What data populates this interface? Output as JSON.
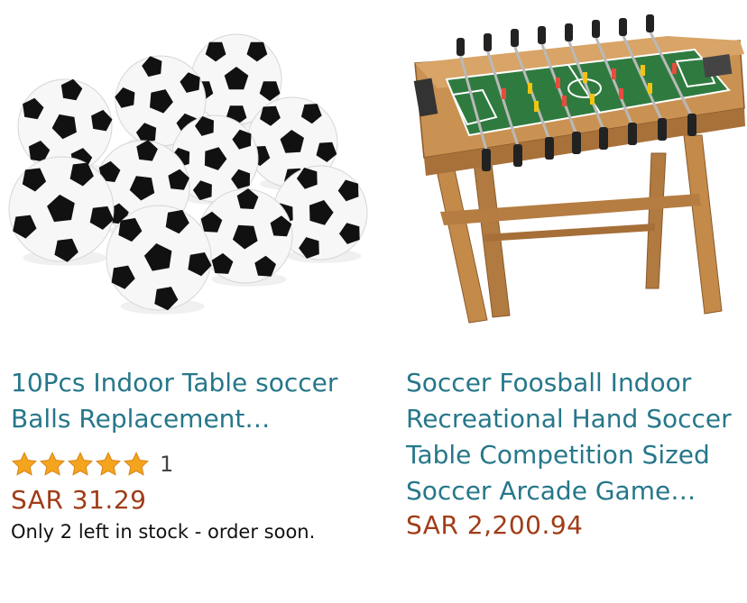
{
  "products": [
    {
      "title": "10Pcs Indoor Table soccer Balls Replacement…",
      "rating_stars": 5,
      "rating_count": "1",
      "price": "SAR 31.29",
      "stock_note": "Only 2 left in stock - order soon.",
      "image_icon": "soccer-balls-image"
    },
    {
      "title": "Soccer Foosball Indoor Recreational Hand Soccer Table Competition Sized Soccer Arcade Game…",
      "price": "SAR 2,200.94",
      "image_icon": "foosball-table-image"
    }
  ],
  "colors": {
    "title": "#26778a",
    "price": "#a03c17",
    "star": "#f4a41d"
  }
}
